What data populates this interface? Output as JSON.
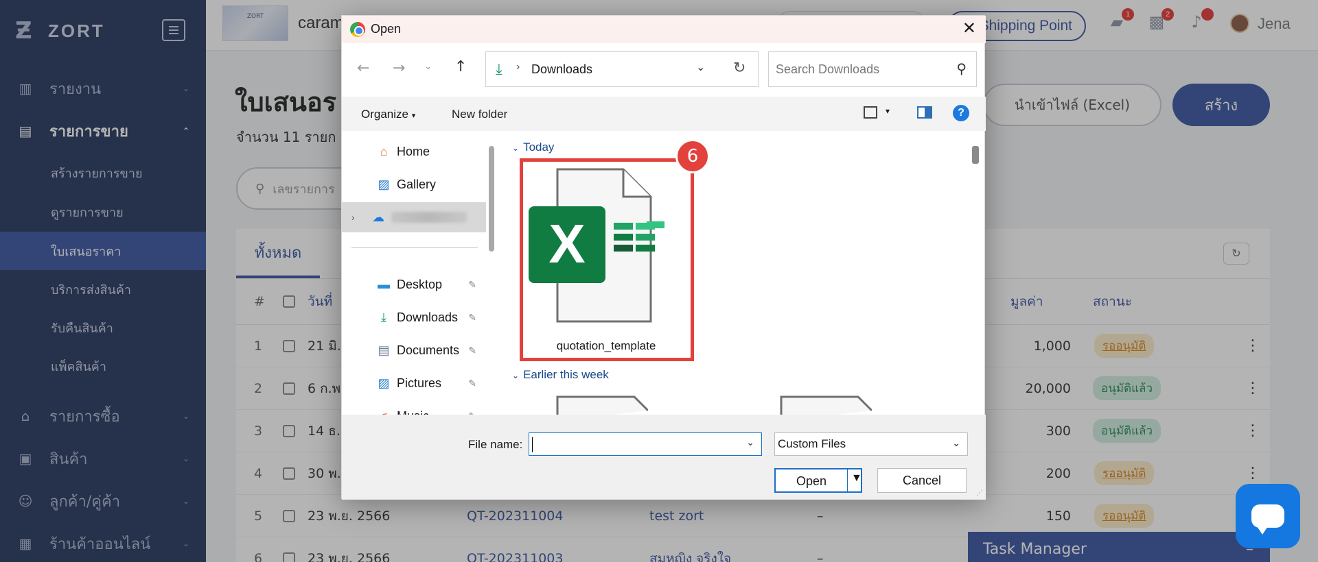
{
  "sidebar": {
    "brand": "ZORT",
    "items": [
      {
        "label": "รายงาน",
        "icon": "bar-chart-icon"
      },
      {
        "label": "รายการขาย",
        "icon": "clipboard-icon"
      },
      {
        "label": "รายการซื้อ",
        "icon": "basket-icon"
      },
      {
        "label": "สินค้า",
        "icon": "box-icon"
      },
      {
        "label": "ลูกค้า/คู่ค้า",
        "icon": "people-icon"
      },
      {
        "label": "ร้านค้าออนไลน์",
        "icon": "store-icon"
      }
    ],
    "sub_items": [
      "สร้างรายการขาย",
      "ดูรายการขาย",
      "ใบเสนอราคา",
      "บริการส่งสินค้า",
      "รับคืนสินค้า",
      "แพ็คสินค้า"
    ]
  },
  "topbar": {
    "store_name": "caram",
    "store_logo_text": "ZORT",
    "shipping_point": "Shipping Point",
    "badge_1": "1",
    "badge_2": "2",
    "username": "Jena"
  },
  "page": {
    "title": "ใบเสนอร",
    "count": "จำนวน 11 รายก",
    "import_button": "นำเข้าไฟล์ (Excel)",
    "create_button": "สร้าง",
    "search_placeholder": "เลขรายการ",
    "tab_all": "ทั้งหมด"
  },
  "table": {
    "headers": {
      "num": "#",
      "date": "วันที่",
      "value": "มูลค่า",
      "status": "สถานะ"
    },
    "rows": [
      {
        "num": "1",
        "date": "21 มิ.",
        "code": "",
        "customer": "",
        "dash": "",
        "value": "1,000",
        "status": "รออนุมัติ",
        "status_type": "pending"
      },
      {
        "num": "2",
        "date": "6 ก.พ",
        "code": "",
        "customer": "",
        "dash": "",
        "value": "20,000",
        "status": "อนุมัติแล้ว",
        "status_type": "approved"
      },
      {
        "num": "3",
        "date": "14 ธ.",
        "code": "",
        "customer": "",
        "dash": "",
        "value": "300",
        "status": "อนุมัติแล้ว",
        "status_type": "approved"
      },
      {
        "num": "4",
        "date": "30 พ.",
        "code": "",
        "customer": "",
        "dash": "",
        "value": "200",
        "status": "รออนุมัติ",
        "status_type": "pending"
      },
      {
        "num": "5",
        "date": "23 พ.ย. 2566",
        "code": "QT-202311004",
        "customer": "test zort",
        "dash": "–",
        "value": "150",
        "status": "รออนุมัติ",
        "status_type": "pending"
      },
      {
        "num": "6",
        "date": "23 พ.ย. 2566",
        "code": "QT-202311003",
        "customer": "สมหญิง จริงใจ",
        "dash": "–",
        "value": "",
        "status": "",
        "status_type": ""
      }
    ]
  },
  "task_manager": {
    "label": "Task Manager",
    "minimize": "–"
  },
  "dialog": {
    "title": "Open",
    "close": "✕",
    "address": "Downloads",
    "search_placeholder": "Search Downloads",
    "organize": "Organize",
    "new_folder": "New folder",
    "help": "?",
    "nav": [
      {
        "label": "Home",
        "icon": "home-icon",
        "pinned": false
      },
      {
        "label": "Gallery",
        "icon": "gallery-icon",
        "pinned": false
      },
      {
        "label": "Desktop",
        "icon": "desktop-icon",
        "pinned": true
      },
      {
        "label": "Downloads",
        "icon": "download-icon",
        "pinned": true
      },
      {
        "label": "Documents",
        "icon": "documents-icon",
        "pinned": true
      },
      {
        "label": "Pictures",
        "icon": "pictures-icon",
        "pinned": true
      },
      {
        "label": "Music",
        "icon": "music-icon",
        "pinned": true
      }
    ],
    "group_today": "Today",
    "group_earlier": "Earlier this week",
    "file_name": "quotation_template",
    "step_number": "6",
    "file_name_label": "File name:",
    "file_name_value": "",
    "file_type": "Custom Files",
    "open_button": "Open",
    "cancel_button": "Cancel"
  },
  "colors": {
    "sidebar_bg": "#253660",
    "accent": "#3a55a1",
    "highlight": "#e3413c",
    "excel_green": "#107c41"
  }
}
